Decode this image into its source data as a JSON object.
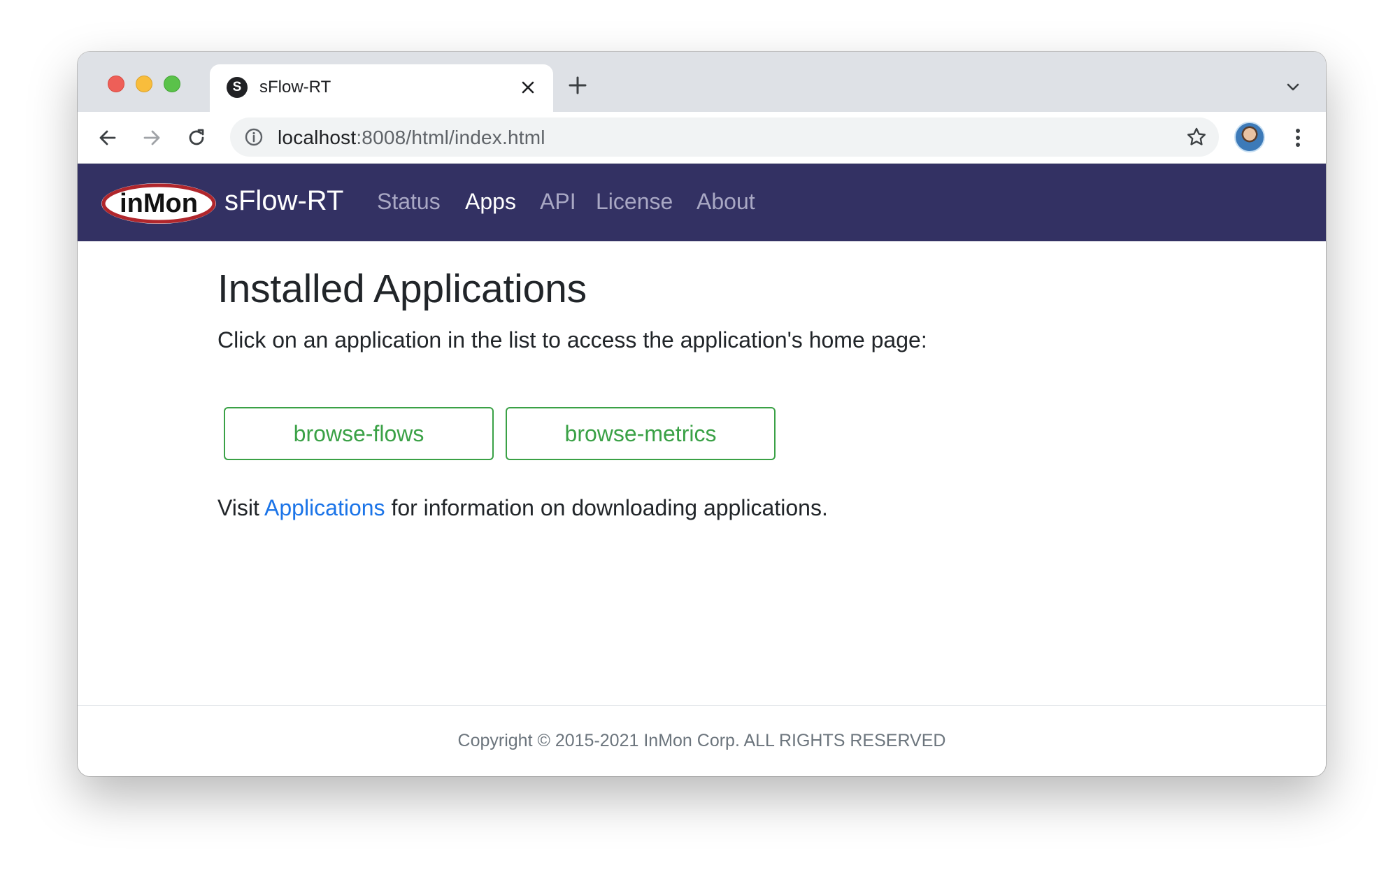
{
  "browser": {
    "tab_title": "sFlow-RT",
    "tab_favicon_letter": "S",
    "url_host": "localhost",
    "url_rest": ":8008/html/index.html"
  },
  "navbar": {
    "logo_text": "inMon",
    "brand": "sFlow-RT",
    "items": [
      {
        "label": "Status",
        "active": false
      },
      {
        "label": "Apps",
        "active": true
      },
      {
        "label": "API",
        "active": false
      },
      {
        "label": "License",
        "active": false
      },
      {
        "label": "About",
        "active": false
      }
    ]
  },
  "main": {
    "heading": "Installed Applications",
    "lead": "Click on an application in the list to access the application's home page:",
    "apps": [
      "browse-flows",
      "browse-metrics"
    ],
    "visit_prefix": "Visit ",
    "visit_link": "Applications",
    "visit_suffix": " for information on downloading applications."
  },
  "footer": {
    "copyright": "Copyright © 2015-2021 InMon Corp. ALL RIGHTS RESERVED"
  },
  "colors": {
    "navbar_bg": "#333163",
    "app_button": "#3aa146",
    "link": "#1b74e8",
    "logo_red": "#b0262c"
  }
}
